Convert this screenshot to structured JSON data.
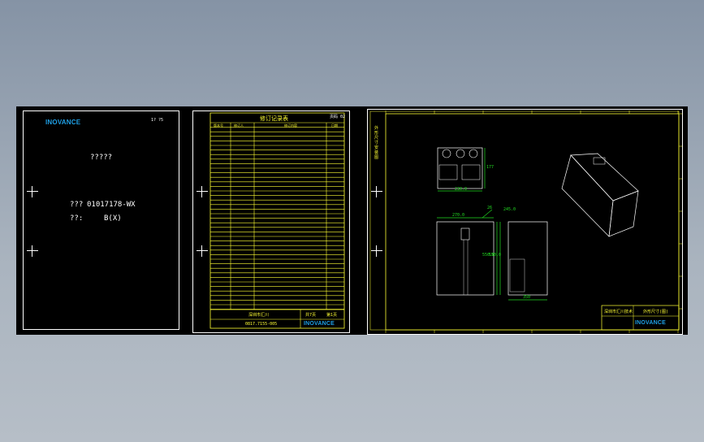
{
  "cover": {
    "brand": "INOVANCE",
    "corner_text": "1?   ?5",
    "title": "?????",
    "code_label": "???",
    "code_value": "01017178-WX",
    "version_label": "??:",
    "version_value": "B(X)"
  },
  "revision_sheet": {
    "title": "修订记录表",
    "page_label": "页码 02",
    "columns": [
      "版本号",
      "修订人",
      "修订内容",
      "日期"
    ],
    "footer_left": "深圳市汇川",
    "footer_code": "0817.7155-005",
    "footer_mid1": "共7页",
    "footer_mid2": "第1页",
    "footer_brand": "INOVANCE"
  },
  "drawing_sheet": {
    "side_text": "外形尺寸安装图",
    "dim_front_top": "270.0",
    "dim_side_bottom": "245.0",
    "dim_top_width": "230.0",
    "dim_top_height": "177",
    "dim_side_h1": "550.0",
    "dim_side_h2": "550.0",
    "dim_side_width": "26",
    "dim_depth": "350",
    "title_block_left": "深圳市汇川技术",
    "title_block_right": "外形尺寸(图)",
    "title_block_brand": "INOVANCE"
  }
}
